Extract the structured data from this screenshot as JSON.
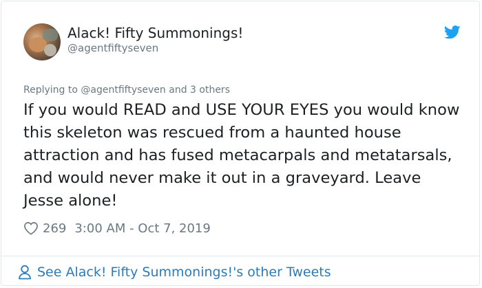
{
  "author": {
    "display_name": "Alack! Fifty Summonings!",
    "handle": "@agentfiftyseven"
  },
  "reply_context": {
    "prefix": "Replying to ",
    "mention": "@agentfiftyseven",
    "suffix": " and 3 others"
  },
  "tweet": {
    "text": "If you would READ and USE YOUR EYES you would know this skeleton was rescued from a haunted house attraction and has fused metacarpals and metatarsals, and would never make it out in a graveyard. Leave Jesse alone!",
    "likes": "269",
    "timestamp": "3:00 AM - Oct 7, 2019"
  },
  "footer": {
    "see_more_label": "See Alack! Fifty Summonings!'s other Tweets"
  },
  "colors": {
    "twitter_blue": "#1da1f2",
    "link_blue": "#2b7bb9",
    "muted_gray": "#697882",
    "border": "#e1e8ed"
  },
  "icons": {
    "brand": "twitter-bird-icon",
    "like": "heart-icon",
    "profile": "person-icon"
  }
}
